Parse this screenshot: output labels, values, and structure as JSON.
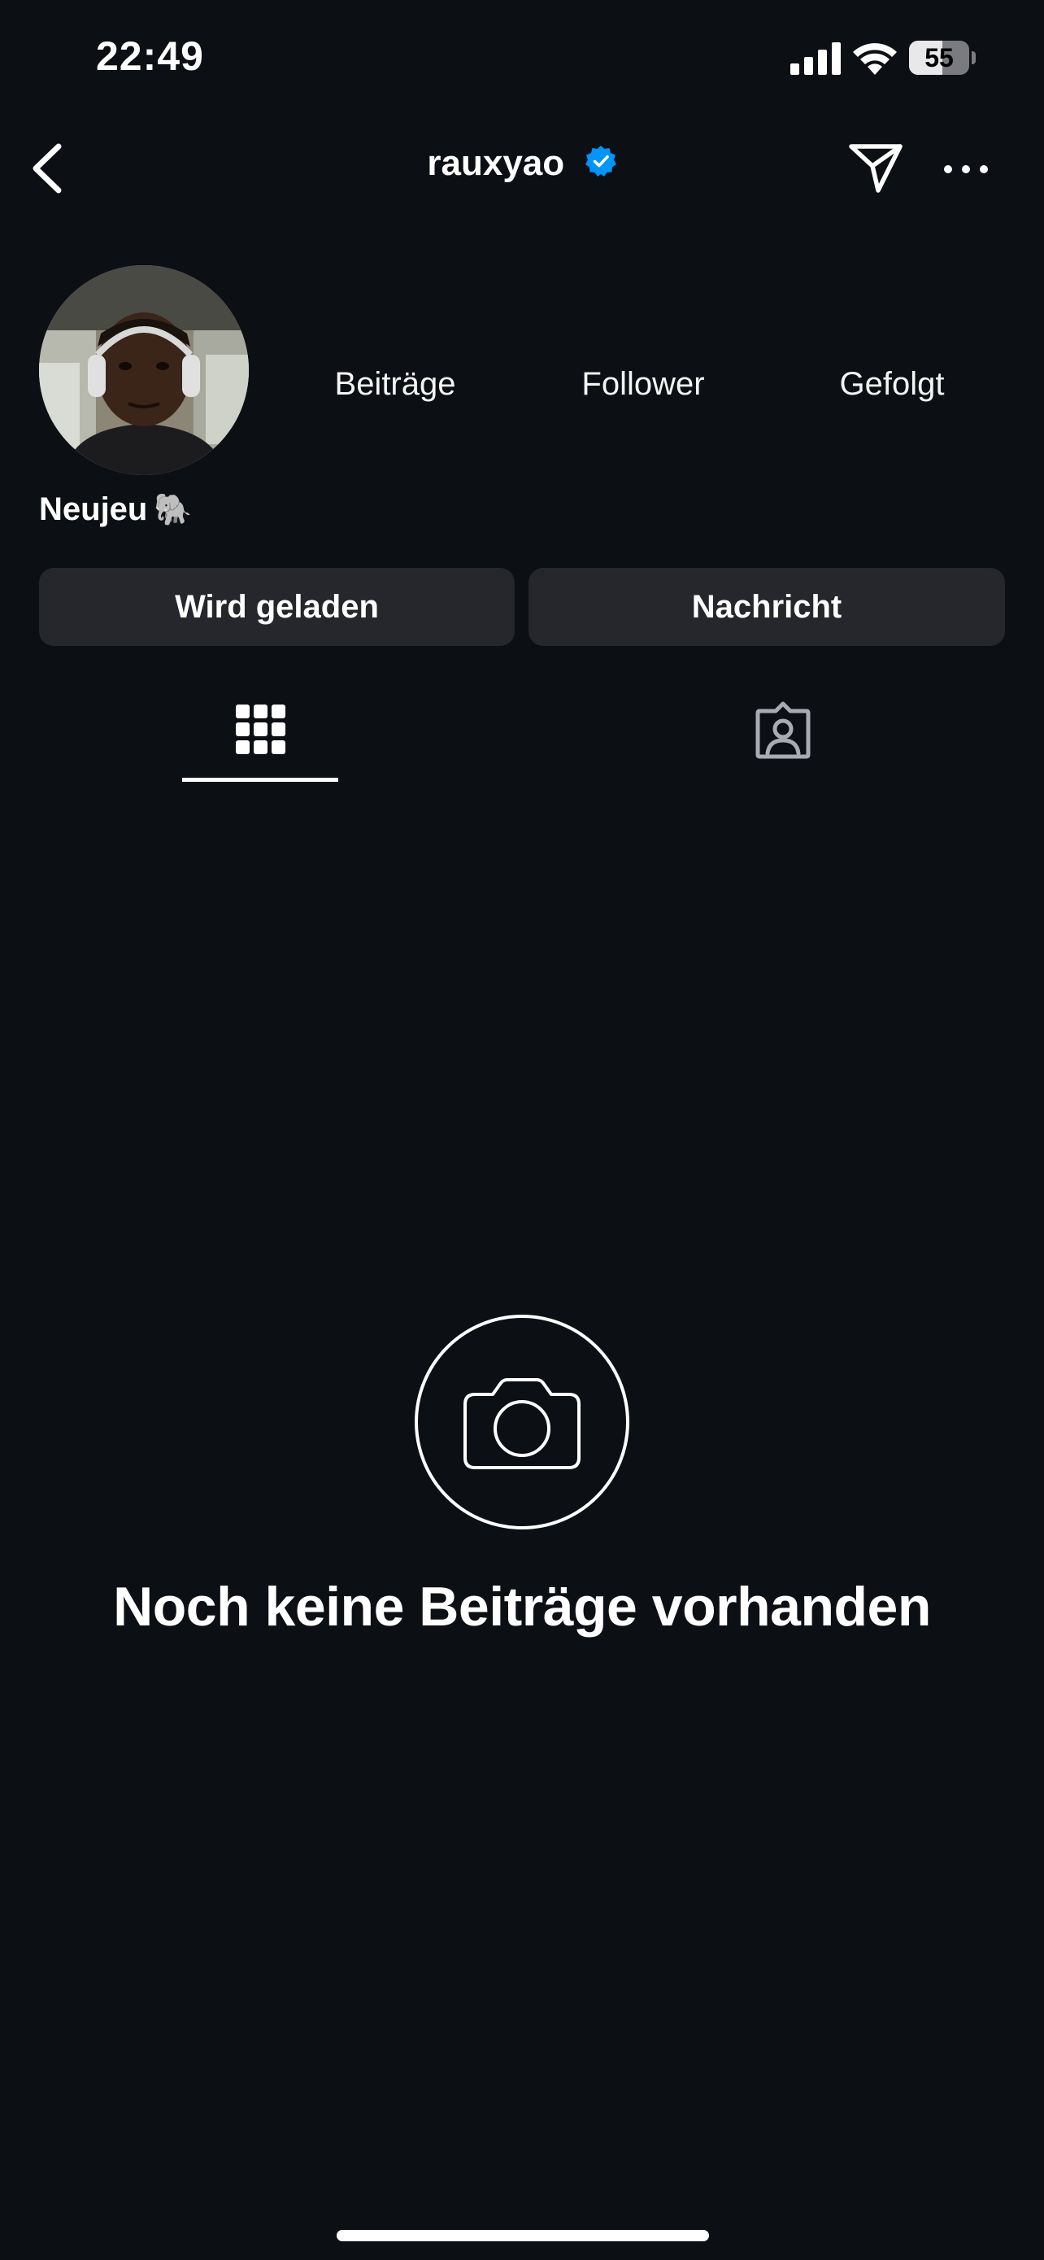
{
  "status_bar": {
    "time": "22:49",
    "battery_level": "55",
    "battery_percent": 55,
    "icons": [
      "cellular-signal-icon",
      "wifi-icon",
      "battery-icon"
    ]
  },
  "nav": {
    "username": "rauxyao",
    "verified": true,
    "icons": [
      "chevron-left-icon",
      "verified-badge-icon",
      "send-icon",
      "more-icon"
    ]
  },
  "profile": {
    "display_name": "Neujeu",
    "name_emoji": "🐘",
    "stats": [
      {
        "label": "Beiträge"
      },
      {
        "label": "Follower"
      },
      {
        "label": "Gefolgt"
      }
    ]
  },
  "actions": {
    "follow_label": "Wird geladen",
    "message_label": "Nachricht"
  },
  "tabs": [
    {
      "name": "posts-grid",
      "icon": "grid-icon",
      "active": true
    },
    {
      "name": "tagged",
      "icon": "tagged-person-icon",
      "active": false
    }
  ],
  "empty_state": {
    "icon": "camera-icon",
    "title": "Noch keine Beiträge vorhanden"
  },
  "colors": {
    "background": "#0c0f14",
    "button": "#25272c",
    "verified": "#0095f6",
    "text": "#ffffff"
  }
}
